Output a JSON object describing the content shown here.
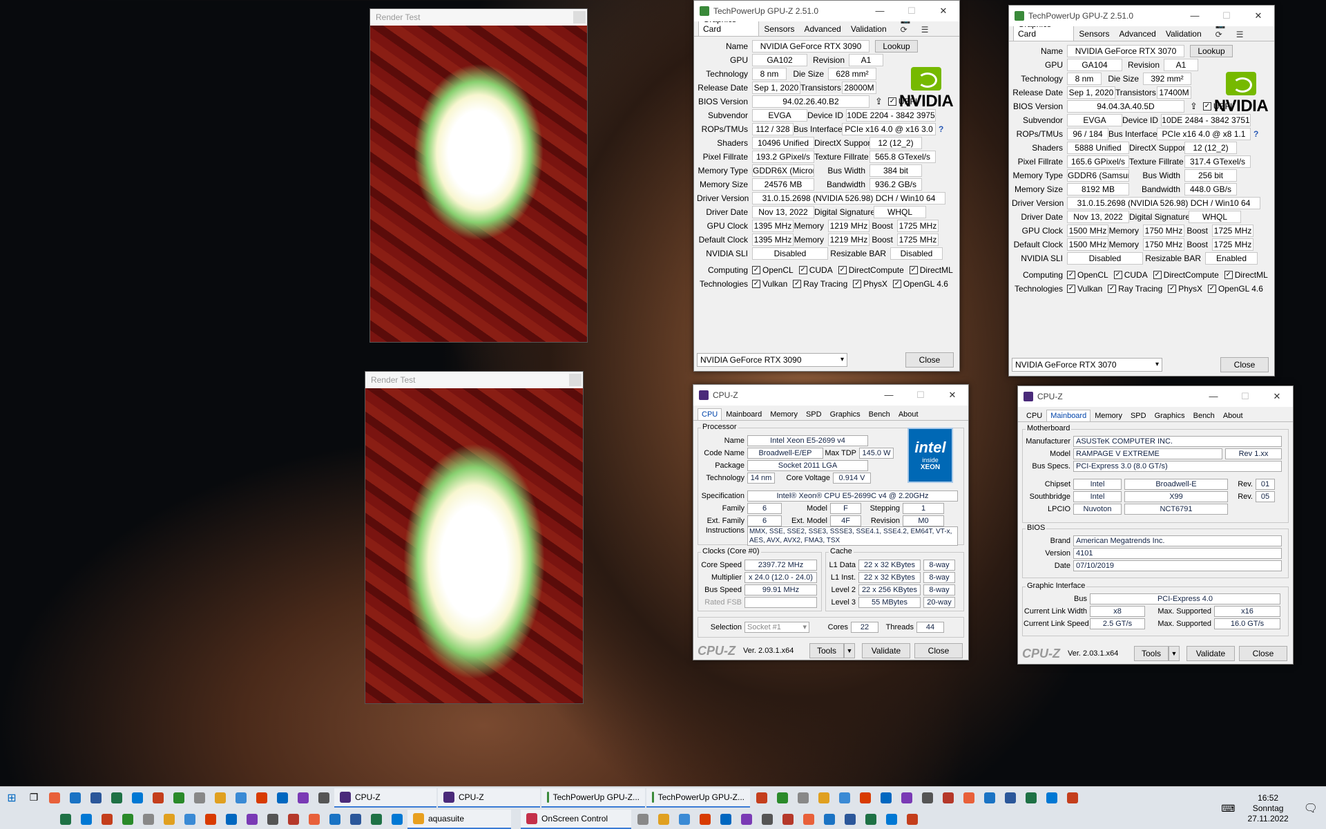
{
  "render_tests": [
    {
      "title": "Render Test"
    },
    {
      "title": "Render Test"
    }
  ],
  "gpuz": [
    {
      "title": "TechPowerUp GPU-Z 2.51.0",
      "tabs": [
        "Graphics Card",
        "Sensors",
        "Advanced",
        "Validation"
      ],
      "lookup": "Lookup",
      "name": "NVIDIA GeForce RTX 3090",
      "gpu": "GA102",
      "revision": "A1",
      "technology": "8 nm",
      "die_size": "628 mm²",
      "release_date": "Sep 1, 2020",
      "transistors": "28000M",
      "bios": "94.02.26.40.B2",
      "uefi": "UEFI",
      "subvendor": "EVGA",
      "device_id": "10DE 2204 - 3842 3975",
      "rops": "112 / 328",
      "bus_interface": "PCIe x16 4.0 @ x16 3.0",
      "shaders": "10496 Unified",
      "directx": "12 (12_2)",
      "pixel_fillrate": "193.2 GPixel/s",
      "texture_fillrate": "565.8 GTexel/s",
      "memory_type": "GDDR6X (Micron)",
      "bus_width": "384 bit",
      "memory_size": "24576 MB",
      "bandwidth": "936.2 GB/s",
      "driver_version": "31.0.15.2698 (NVIDIA 526.98) DCH / Win10 64",
      "driver_date": "Nov 13, 2022",
      "digital_signature": "WHQL",
      "gpu_clock": "1395 MHz",
      "memory": "1219 MHz",
      "boost": "1725 MHz",
      "default_clock": "1395 MHz",
      "def_memory": "1219 MHz",
      "def_boost": "1725 MHz",
      "sli": "Disabled",
      "rebar": "Disabled",
      "selected": "NVIDIA GeForce RTX 3090",
      "close": "Close"
    },
    {
      "title": "TechPowerUp GPU-Z 2.51.0",
      "tabs": [
        "Graphics Card",
        "Sensors",
        "Advanced",
        "Validation"
      ],
      "lookup": "Lookup",
      "name": "NVIDIA GeForce RTX 3070",
      "gpu": "GA104",
      "revision": "A1",
      "technology": "8 nm",
      "die_size": "392 mm²",
      "release_date": "Sep 1, 2020",
      "transistors": "17400M",
      "bios": "94.04.3A.40.5D",
      "uefi": "UEFI",
      "subvendor": "EVGA",
      "device_id": "10DE 2484 - 3842 3751",
      "rops": "96 / 184",
      "bus_interface": "PCIe x16 4.0 @ x8 1.1",
      "shaders": "5888 Unified",
      "directx": "12 (12_2)",
      "pixel_fillrate": "165.6 GPixel/s",
      "texture_fillrate": "317.4 GTexel/s",
      "memory_type": "GDDR6 (Samsung)",
      "bus_width": "256 bit",
      "memory_size": "8192 MB",
      "bandwidth": "448.0 GB/s",
      "driver_version": "31.0.15.2698 (NVIDIA 526.98) DCH / Win10 64",
      "driver_date": "Nov 13, 2022",
      "digital_signature": "WHQL",
      "gpu_clock": "1500 MHz",
      "memory": "1750 MHz",
      "boost": "1725 MHz",
      "default_clock": "1500 MHz",
      "def_memory": "1750 MHz",
      "def_boost": "1725 MHz",
      "sli": "Disabled",
      "rebar": "Enabled",
      "selected": "NVIDIA GeForce RTX 3070",
      "close": "Close"
    }
  ],
  "gpuz_labels": {
    "name": "Name",
    "gpu": "GPU",
    "revision": "Revision",
    "technology": "Technology",
    "die_size": "Die Size",
    "release_date": "Release Date",
    "transistors": "Transistors",
    "bios": "BIOS Version",
    "subvendor": "Subvendor",
    "device_id": "Device ID",
    "rops": "ROPs/TMUs",
    "bus_interface": "Bus Interface",
    "shaders": "Shaders",
    "directx": "DirectX Support",
    "pixel_fillrate": "Pixel Fillrate",
    "texture_fillrate": "Texture Fillrate",
    "memory_type": "Memory Type",
    "bus_width": "Bus Width",
    "memory_size": "Memory Size",
    "bandwidth": "Bandwidth",
    "driver_version": "Driver Version",
    "driver_date": "Driver Date",
    "digital_signature": "Digital Signature",
    "gpu_clock": "GPU Clock",
    "memory": "Memory",
    "boost": "Boost",
    "default_clock": "Default Clock",
    "sli": "NVIDIA SLI",
    "rebar": "Resizable BAR",
    "computing": "Computing",
    "technologies": "Technologies",
    "nvidia": "NVIDIA"
  },
  "computing": [
    "OpenCL",
    "CUDA",
    "DirectCompute",
    "DirectML"
  ],
  "technologies": [
    "Vulkan",
    "Ray Tracing",
    "PhysX",
    "OpenGL 4.6"
  ],
  "cpuz_cpu": {
    "title": "CPU-Z",
    "tabs": [
      "CPU",
      "Mainboard",
      "Memory",
      "SPD",
      "Graphics",
      "Bench",
      "About"
    ],
    "processor": "Processor",
    "name_l": "Name",
    "name": "Intel Xeon E5-2699 v4",
    "codename_l": "Code Name",
    "codename": "Broadwell-E/EP",
    "maxtdp_l": "Max TDP",
    "maxtdp": "145.0 W",
    "package_l": "Package",
    "package": "Socket 2011 LGA",
    "tech_l": "Technology",
    "tech": "14 nm",
    "voltage_l": "Core Voltage",
    "voltage": "0.914 V",
    "spec_l": "Specification",
    "spec": "Intel® Xeon® CPU E5-2699C v4 @ 2.20GHz",
    "family_l": "Family",
    "family": "6",
    "model_l": "Model",
    "model": "F",
    "stepping_l": "Stepping",
    "stepping": "1",
    "extfamily_l": "Ext. Family",
    "extfamily": "6",
    "extmodel_l": "Ext. Model",
    "extmodel": "4F",
    "revision_l": "Revision",
    "revision": "M0",
    "instr_l": "Instructions",
    "instr": "MMX, SSE, SSE2, SSE3, SSSE3, SSE4.1, SSE4.2, EM64T, VT-x, AES, AVX, AVX2, FMA3, TSX",
    "clocks": "Clocks (Core #0)",
    "corespeed_l": "Core Speed",
    "corespeed": "2397.72 MHz",
    "mult_l": "Multiplier",
    "mult": "x 24.0 (12.0 - 24.0)",
    "bus_l": "Bus Speed",
    "bus": "99.91 MHz",
    "ratedfsb_l": "Rated FSB",
    "cache": "Cache",
    "l1d_l": "L1 Data",
    "l1d": "22 x 32 KBytes",
    "l1d_w": "8-way",
    "l1i_l": "L1 Inst.",
    "l1i": "22 x 32 KBytes",
    "l1i_w": "8-way",
    "l2_l": "Level 2",
    "l2": "22 x 256 KBytes",
    "l2_w": "8-way",
    "l3_l": "Level 3",
    "l3": "55 MBytes",
    "l3_w": "20-way",
    "selection_l": "Selection",
    "selection": "Socket #1",
    "cores_l": "Cores",
    "cores": "22",
    "threads_l": "Threads",
    "threads": "44",
    "brand": "CPU-Z",
    "ver": "Ver. 2.03.1.x64",
    "tools": "Tools",
    "validate": "Validate",
    "close": "Close",
    "intel": "intel",
    "inside": "inside",
    "xeon": "XEON"
  },
  "cpuz_mb": {
    "title": "CPU-Z",
    "tabs": [
      "CPU",
      "Mainboard",
      "Memory",
      "SPD",
      "Graphics",
      "Bench",
      "About"
    ],
    "motherboard": "Motherboard",
    "manufacturer_l": "Manufacturer",
    "manufacturer": "ASUSTeK COMPUTER INC.",
    "model_l": "Model",
    "model": "RAMPAGE V EXTREME",
    "model_rev": "Rev 1.xx",
    "busspecs_l": "Bus Specs.",
    "busspecs": "PCI-Express 3.0 (8.0 GT/s)",
    "chipset_l": "Chipset",
    "chipset_v": "Intel",
    "chipset": "Broadwell-E",
    "rev_l": "Rev.",
    "chipset_rev": "01",
    "south_l": "Southbridge",
    "south_v": "Intel",
    "south": "X99",
    "south_rev": "05",
    "lpcio_l": "LPCIO",
    "lpcio_v": "Nuvoton",
    "lpcio": "NCT6791",
    "bios": "BIOS",
    "brand_l": "Brand",
    "brand": "American Megatrends Inc.",
    "version_l": "Version",
    "version": "4101",
    "date_l": "Date",
    "date": "07/10/2019",
    "gi": "Graphic Interface",
    "bus_l": "Bus",
    "bus": "PCI-Express 4.0",
    "clw_l": "Current Link Width",
    "clw": "x8",
    "msw_l": "Max. Supported",
    "msw": "x16",
    "cls_l": "Current Link Speed",
    "cls": "2.5 GT/s",
    "mss_l": "Max. Supported",
    "mss": "16.0 GT/s",
    "cpuz": "CPU-Z",
    "ver": "Ver. 2.03.1.x64",
    "tools": "Tools",
    "validate": "Validate",
    "close": "Close"
  },
  "taskbar": {
    "row1_apps": [
      {
        "label": "CPU-Z"
      },
      {
        "label": "CPU-Z"
      },
      {
        "label": "TechPowerUp GPU-Z..."
      },
      {
        "label": "TechPowerUp GPU-Z..."
      }
    ],
    "row2_apps": [
      {
        "label": "aquasuite"
      },
      {
        "label": "OnScreen Control"
      }
    ],
    "time": "16:52",
    "day": "Sonntag",
    "date": "27.11.2022"
  }
}
